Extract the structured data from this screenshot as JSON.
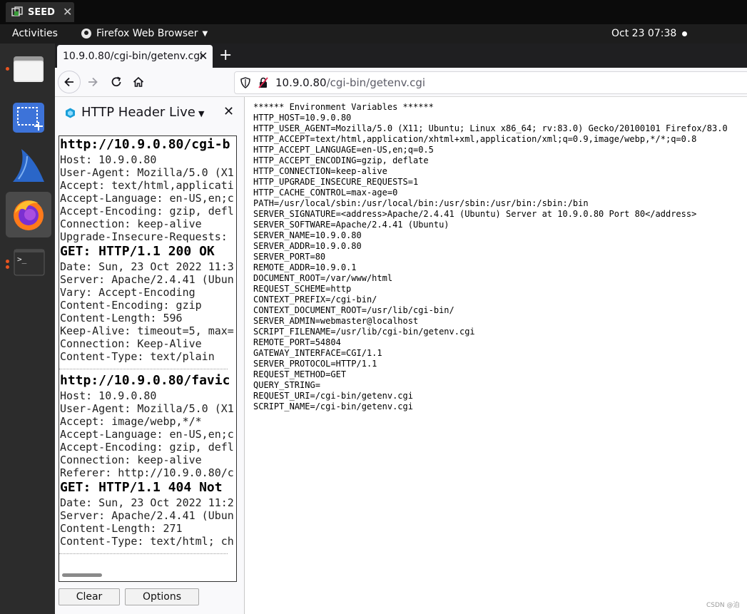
{
  "vm": {
    "tab_label": "SEED",
    "close": "✕"
  },
  "topbar": {
    "activities": "Activities",
    "app_name": "Firefox Web Browser",
    "clock": "Oct 23  07:38"
  },
  "browser": {
    "tab_title": "10.9.0.80/cgi-bin/getenv.cgi",
    "new_tab": "+",
    "url_host": "10.9.0.80",
    "url_path": "/cgi-bin/getenv.cgi"
  },
  "sidebar": {
    "title": "HTTP Header Live",
    "entries": [
      {
        "request_url": "http://10.9.0.80/cgi-b",
        "request_headers": [
          "Host: 10.9.0.80",
          "User-Agent: Mozilla/5.0 (X1",
          "Accept: text/html,applicati",
          "Accept-Language: en-US,en;c",
          "Accept-Encoding: gzip, defl",
          "Connection: keep-alive",
          "Upgrade-Insecure-Requests: "
        ],
        "status": "GET: HTTP/1.1 200 OK",
        "response_headers": [
          "Date: Sun, 23 Oct 2022 11:3",
          "Server: Apache/2.4.41 (Ubun",
          "Vary: Accept-Encoding",
          "Content-Encoding: gzip",
          "Content-Length: 596",
          "Keep-Alive: timeout=5, max=",
          "Connection: Keep-Alive",
          "Content-Type: text/plain"
        ]
      },
      {
        "request_url": "http://10.9.0.80/favic",
        "request_headers": [
          "Host: 10.9.0.80",
          "User-Agent: Mozilla/5.0 (X1",
          "Accept: image/webp,*/*",
          "Accept-Language: en-US,en;c",
          "Accept-Encoding: gzip, defl",
          "Connection: keep-alive",
          "Referer: http://10.9.0.80/c"
        ],
        "status": "GET: HTTP/1.1 404 Not ",
        "response_headers": [
          "Date: Sun, 23 Oct 2022 11:2",
          "Server: Apache/2.4.41 (Ubun",
          "Content-Length: 271",
          "Content-Type: text/html; ch"
        ]
      }
    ],
    "clear_label": "Clear",
    "options_label": "Options"
  },
  "content": {
    "lines": [
      "****** Environment Variables ******",
      "HTTP_HOST=10.9.0.80",
      "HTTP_USER_AGENT=Mozilla/5.0 (X11; Ubuntu; Linux x86_64; rv:83.0) Gecko/20100101 Firefox/83.0",
      "HTTP_ACCEPT=text/html,application/xhtml+xml,application/xml;q=0.9,image/webp,*/*;q=0.8",
      "HTTP_ACCEPT_LANGUAGE=en-US,en;q=0.5",
      "HTTP_ACCEPT_ENCODING=gzip, deflate",
      "HTTP_CONNECTION=keep-alive",
      "HTTP_UPGRADE_INSECURE_REQUESTS=1",
      "HTTP_CACHE_CONTROL=max-age=0",
      "PATH=/usr/local/sbin:/usr/local/bin:/usr/sbin:/usr/bin:/sbin:/bin",
      "SERVER_SIGNATURE=<address>Apache/2.4.41 (Ubuntu) Server at 10.9.0.80 Port 80</address>",
      "SERVER_SOFTWARE=Apache/2.4.41 (Ubuntu)",
      "SERVER_NAME=10.9.0.80",
      "SERVER_ADDR=10.9.0.80",
      "SERVER_PORT=80",
      "REMOTE_ADDR=10.9.0.1",
      "DOCUMENT_ROOT=/var/www/html",
      "REQUEST_SCHEME=http",
      "CONTEXT_PREFIX=/cgi-bin/",
      "CONTEXT_DOCUMENT_ROOT=/usr/lib/cgi-bin/",
      "SERVER_ADMIN=webmaster@localhost",
      "SCRIPT_FILENAME=/usr/lib/cgi-bin/getenv.cgi",
      "REMOTE_PORT=54804",
      "GATEWAY_INTERFACE=CGI/1.1",
      "SERVER_PROTOCOL=HTTP/1.1",
      "REQUEST_METHOD=GET",
      "QUERY_STRING=",
      "REQUEST_URI=/cgi-bin/getenv.cgi",
      "SCRIPT_NAME=/cgi-bin/getenv.cgi"
    ]
  },
  "watermark": "CSDN @泊",
  "icons": {
    "dock": [
      "files-icon",
      "screenshot-icon",
      "wireshark-icon",
      "firefox-icon",
      "terminal-icon"
    ],
    "terminal_glyph": ">_"
  },
  "colors": {
    "accent": "#e95420",
    "dock_bg": "#2c2c2c",
    "topbar_bg": "#1d1d1d"
  }
}
